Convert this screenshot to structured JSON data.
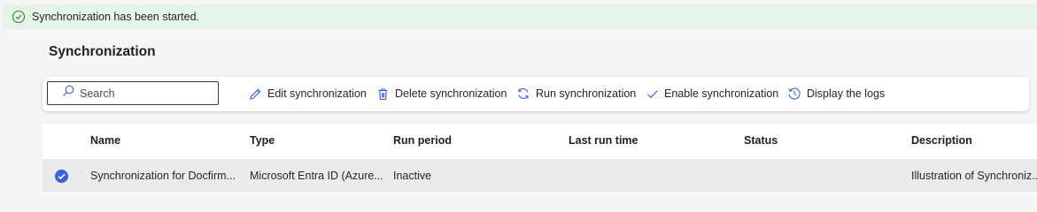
{
  "banner": {
    "message": "Synchronization has been started.",
    "icon": "check-circle-icon",
    "color": "#e6f4e7"
  },
  "page": {
    "title": "Synchronization"
  },
  "toolbar": {
    "search_placeholder": "Search",
    "edit_label": "Edit synchronization",
    "delete_label": "Delete synchronization",
    "run_label": "Run synchronization",
    "enable_label": "Enable synchronization",
    "logs_label": "Display the logs"
  },
  "table": {
    "columns": [
      "Name",
      "Type",
      "Run period",
      "Last run time",
      "Status",
      "Description"
    ],
    "rows": [
      {
        "selected": true,
        "name": "Synchronization for Docfirm...",
        "type": "Microsoft Entra ID (Azure...",
        "run_period": "Inactive",
        "last_run_time": "",
        "status": "",
        "description": "Illustration of Synchroniz..."
      }
    ]
  },
  "colors": {
    "accent": "#3a5fe0",
    "success_bg": "#e6f4e7",
    "icon": "#3a5fe0"
  }
}
